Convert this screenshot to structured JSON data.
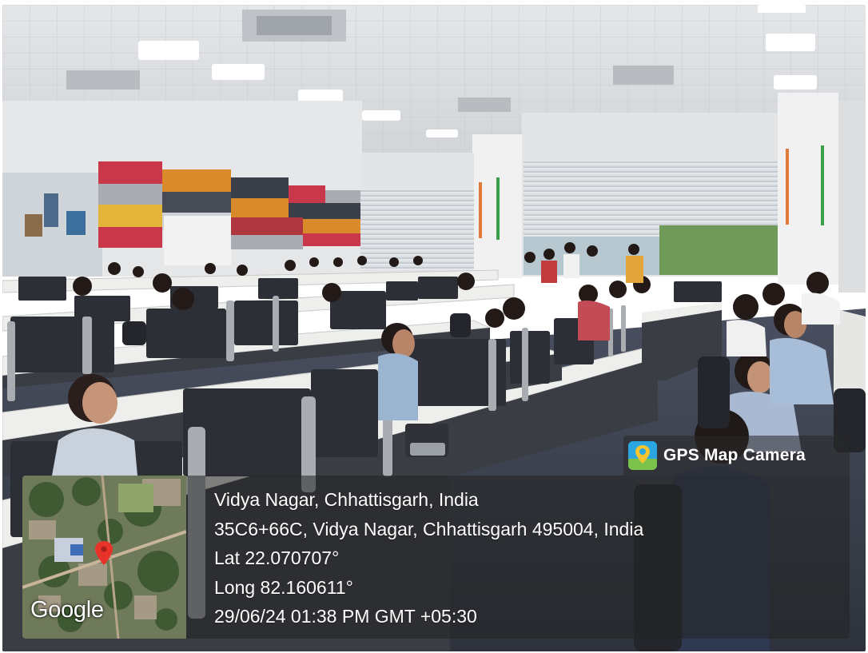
{
  "badge": {
    "label": "GPS Map Camera",
    "icon": "map-pin-icon",
    "icon_color": "#2aa6e0"
  },
  "map": {
    "provider_logo": "Google",
    "pin_color": "#e8332b"
  },
  "location": {
    "place": "Vidya Nagar, Chhattisgarh, India",
    "address": "35C6+66C, Vidya Nagar, Chhattisgarh 495004, India",
    "latitude": "Lat 22.070707°",
    "longitude": "Long 82.160611°",
    "timestamp": "29/06/24 01:38 PM GMT +05:30"
  }
}
